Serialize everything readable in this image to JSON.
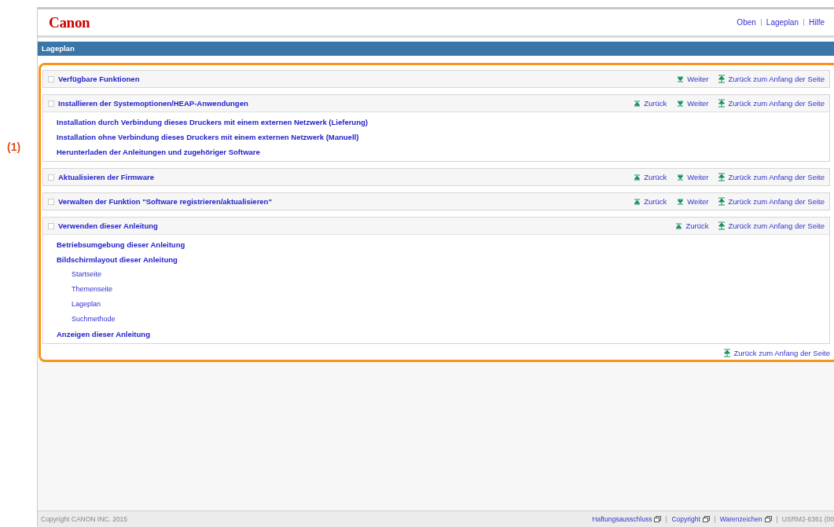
{
  "logo": "Canon",
  "header_links": [
    "Oben",
    "Lageplan",
    "Hilfe"
  ],
  "title_bar": "Lageplan",
  "callout": "(1)",
  "sections": [
    {
      "title": "Verfügbare Funktionen",
      "nav": [
        {
          "kind": "next",
          "label": "Weiter"
        },
        {
          "kind": "top",
          "label": "Zurück zum Anfang der Seite"
        }
      ]
    },
    {
      "title": "Installieren der Systemoptionen/HEAP-Anwendungen",
      "nav": [
        {
          "kind": "prev",
          "label": "Zurück"
        },
        {
          "kind": "next",
          "label": "Weiter"
        },
        {
          "kind": "top",
          "label": "Zurück zum Anfang der Seite"
        }
      ],
      "items": [
        {
          "label": "Installation durch Verbindung dieses Druckers mit einem externen Netzwerk (Lieferung)"
        },
        {
          "label": "Installation ohne Verbindung dieses Druckers mit einem externen Netzwerk (Manuell)"
        },
        {
          "label": "Herunterladen der Anleitungen und zugehöriger Software"
        }
      ]
    },
    {
      "title": "Aktualisieren der Firmware",
      "nav": [
        {
          "kind": "prev",
          "label": "Zurück"
        },
        {
          "kind": "next",
          "label": "Weiter"
        },
        {
          "kind": "top",
          "label": "Zurück zum Anfang der Seite"
        }
      ]
    },
    {
      "title": "Verwalten der Funktion \"Software registrieren/aktualisieren\"",
      "nav": [
        {
          "kind": "prev",
          "label": "Zurück"
        },
        {
          "kind": "next",
          "label": "Weiter"
        },
        {
          "kind": "top",
          "label": "Zurück zum Anfang der Seite"
        }
      ]
    },
    {
      "title": "Verwenden dieser Anleitung",
      "nav": [
        {
          "kind": "prev",
          "label": "Zurück"
        },
        {
          "kind": "top",
          "label": "Zurück zum Anfang der Seite"
        }
      ],
      "items": [
        {
          "label": "Betriebsumgebung dieser Anleitung"
        },
        {
          "label": "Bildschirmlayout dieser Anleitung",
          "children": [
            {
              "label": "Startseite"
            },
            {
              "label": "Themenseite"
            },
            {
              "label": "Lageplan"
            },
            {
              "label": "Suchmethode"
            }
          ]
        },
        {
          "label": "Anzeigen dieser Anleitung"
        }
      ]
    }
  ],
  "page_top": "Zurück zum Anfang der Seite",
  "footer": {
    "copyright": "Copyright CANON INC. 2015",
    "links": [
      "Haftungsausschluss",
      "Copyright",
      "Warenzeichen"
    ],
    "code": "USRM2-6361 (00"
  }
}
